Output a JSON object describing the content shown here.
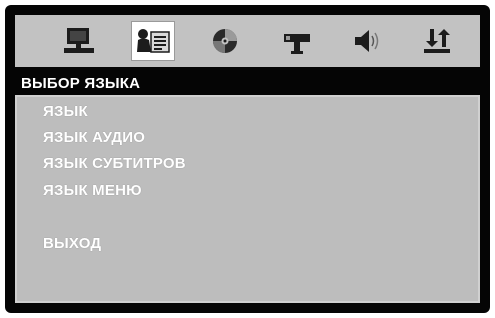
{
  "icon_bar": {
    "tabs": [
      {
        "icon": "monitor-icon"
      },
      {
        "icon": "language-settings-icon",
        "active": true
      },
      {
        "icon": "disc-icon"
      },
      {
        "icon": "video-settings-icon"
      },
      {
        "icon": "speaker-icon"
      },
      {
        "icon": "preferences-icon"
      }
    ]
  },
  "menu": {
    "title": "ВЫБОР ЯЗЫКА",
    "items": [
      "ЯЗЫК",
      "ЯЗЫК АУДИО",
      "ЯЗЫК СУБТИТРОВ",
      "ЯЗЫК МЕНЮ"
    ],
    "exit": "ВЫХОД"
  },
  "colors": {
    "screen_bg": "#050505",
    "bar_bg": "#c2c2c2",
    "panel_bg": "#bdbdbd",
    "text": "#ffffff"
  }
}
